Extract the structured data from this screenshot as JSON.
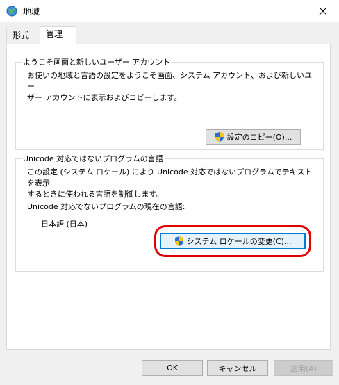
{
  "window": {
    "title": "地域"
  },
  "tabs": [
    {
      "label": "形式",
      "active": false
    },
    {
      "label": "管理",
      "active": true
    }
  ],
  "welcome_group": {
    "title": "ようこそ画面と新しいユーザー アカウント",
    "line1": "お使いの地域と言語の設定をようこそ画面、システム アカウント、および新しいユー",
    "line2": "ザー アカウントに表示およびコピーします。",
    "copy_button": "設定のコピー(O)..."
  },
  "unicode_group": {
    "title": "Unicode 対応ではないプログラムの言語",
    "line1": "この設定 (システム ロケール) により Unicode 対応ではないプログラムでテキストを表示",
    "line2": "するときに使われる言語を制御します。",
    "current_label": "Unicode 対応でないプログラムの現在の言語:",
    "current_value": "日本語 (日本)",
    "change_button": "システム ロケールの変更(C)..."
  },
  "footer": {
    "ok": "OK",
    "cancel": "キャンセル",
    "apply": "適用(A)"
  },
  "colors": {
    "accent": "#0078d7",
    "annotation": "#e00000"
  },
  "icons": {
    "title": "globe-icon",
    "close": "close-icon",
    "uac": "uac-shield-icon"
  }
}
